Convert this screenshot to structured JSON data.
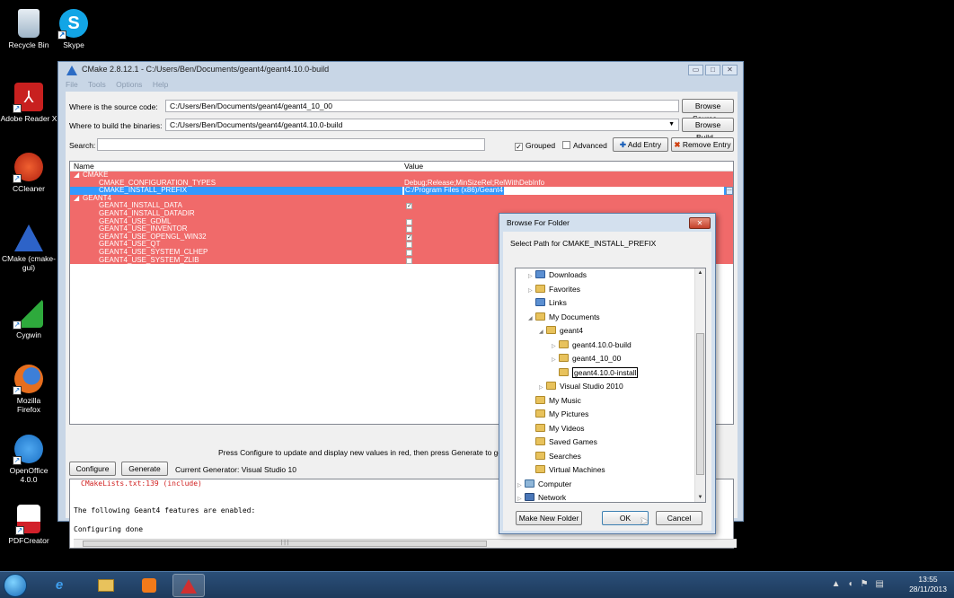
{
  "desktop": {
    "icons": [
      {
        "label": "Recycle Bin",
        "icon": "recycle-bin-icon",
        "color": "#9fb5c8"
      },
      {
        "label": "Skype",
        "icon": "skype-icon",
        "color": "#12a5e6"
      },
      {
        "label": "Adobe Reader X",
        "icon": "adobe-reader-icon",
        "color": "#c8201f"
      },
      {
        "label": "CCleaner",
        "icon": "ccleaner-icon",
        "color": "#d23b22"
      },
      {
        "label": "CMake (cmake-gui)",
        "icon": "cmake-icon",
        "color": "#2d63c8"
      },
      {
        "label": "Cygwin",
        "icon": "cygwin-icon",
        "color": "#2eaa3c"
      },
      {
        "label": "Mozilla Firefox",
        "icon": "firefox-icon",
        "color": "#e66e1e"
      },
      {
        "label": "OpenOffice 4.0.0",
        "icon": "openoffice-icon",
        "color": "#1a6fc4"
      },
      {
        "label": "PDFCreator",
        "icon": "pdfcreator-icon",
        "color": "#d2202a"
      }
    ]
  },
  "cmake": {
    "title": "CMake 2.8.12.1 - C:/Users/Ben/Documents/geant4/geant4.10.0-build",
    "menu": [
      "File",
      "Tools",
      "Options",
      "Help"
    ],
    "source_label": "Where is the source code:",
    "source_value": "C:/Users/Ben/Documents/geant4/geant4_10_00",
    "browse_source": "Browse Source...",
    "build_label": "Where to build the binaries:",
    "build_value": "C:/Users/Ben/Documents/geant4/geant4.10.0-build",
    "browse_build": "Browse Build...",
    "search_label": "Search:",
    "search_value": "",
    "grouped_label": "Grouped",
    "grouped_checked": true,
    "advanced_label": "Advanced",
    "advanced_checked": false,
    "add_entry": "Add Entry",
    "remove_entry": "Remove Entry",
    "col_name": "Name",
    "col_value": "Value",
    "groups": {
      "cmake": "CMAKE",
      "cmake_types": "CMAKE_CONFIGURATION_TYPES",
      "cmake_types_value": "Debug;Release;MinSizeRel;RelWithDebInfo",
      "cmake_prefix": "CMAKE_INSTALL_PREFIX",
      "cmake_prefix_value": "C:/Program Files (x86)/Geant4",
      "geant4": "GEANT4",
      "g_install_data": "GEANT4_INSTALL_DATA",
      "g_install_datadir": "GEANT4_INSTALL_DATADIR",
      "g_gdml": "GEANT4_USE_GDML",
      "g_inventor": "GEANT4_USE_INVENTOR",
      "g_opengl": "GEANT4_USE_OPENGL_WIN32",
      "g_qt": "GEANT4_USE_QT",
      "g_clhep": "GEANT4_USE_SYSTEM_CLHEP",
      "g_zlib": "GEANT4_USE_SYSTEM_ZLIB"
    },
    "hint": "Press Configure to update and display new values in red, then press Generate to ger",
    "configure": "Configure",
    "generate": "Generate",
    "generator": "Current Generator: Visual Studio 10",
    "output": {
      "line1": "CMakeLists.txt:139 (include)",
      "line2": "The following Geant4 features are enabled:",
      "line3": "Configuring done"
    }
  },
  "dialog": {
    "title": "Browse For Folder",
    "prompt": "Select Path for CMAKE_INSTALL_PREFIX",
    "folders": {
      "downloads": "Downloads",
      "favorites": "Favorites",
      "links": "Links",
      "my_documents": "My Documents",
      "geant4": "geant4",
      "build": "geant4.10.0-build",
      "src": "geant4_10_00",
      "install": "geant4.10.0-install",
      "vs2010": "Visual Studio 2010",
      "music": "My Music",
      "pictures": "My Pictures",
      "videos": "My Videos",
      "saved_games": "Saved Games",
      "searches": "Searches",
      "vms": "Virtual Machines",
      "computer": "Computer",
      "network": "Network"
    },
    "make_new_folder": "Make New Folder",
    "ok": "OK",
    "cancel": "Cancel"
  },
  "taskbar": {
    "time": "13:55",
    "date": "28/11/2013"
  }
}
